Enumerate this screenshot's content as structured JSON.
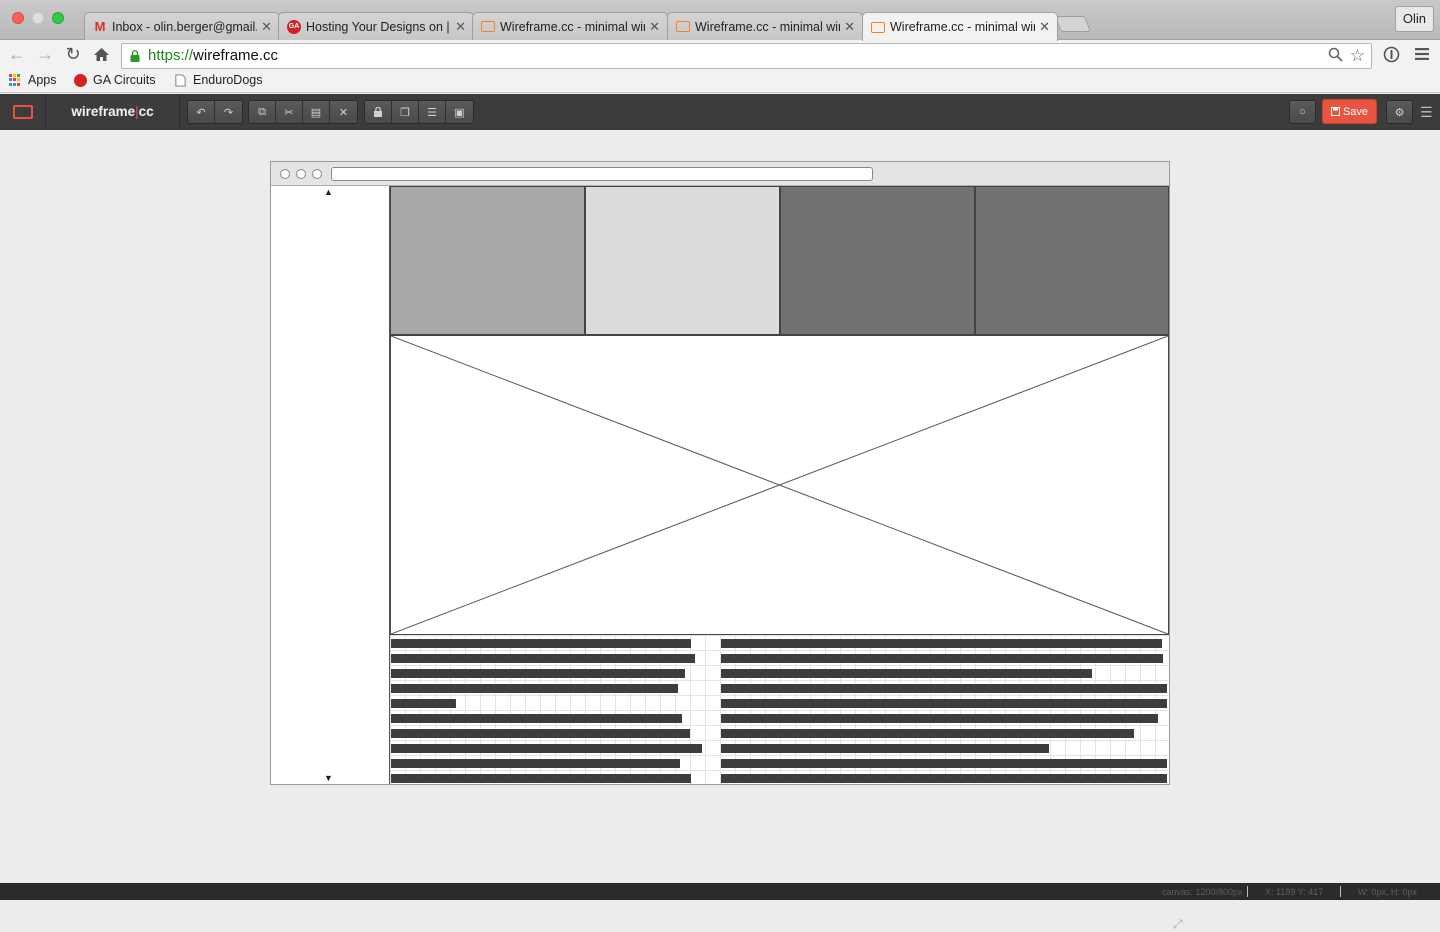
{
  "browser": {
    "tabs": [
      {
        "title": "Inbox - olin.berger@gmail.c",
        "favicon": "gmail-icon"
      },
      {
        "title": "Hosting Your Designs on | ",
        "favicon": "ga-circuits-icon"
      },
      {
        "title": "Wireframe.cc - minimal wir",
        "favicon": "wireframe-icon"
      },
      {
        "title": "Wireframe.cc - minimal wir",
        "favicon": "wireframe-icon"
      },
      {
        "title": "Wireframe.cc - minimal wir",
        "favicon": "wireframe-icon",
        "active": true
      }
    ],
    "profile": "Olin",
    "url_scheme": "https://",
    "url_host": "wireframe.cc",
    "bookmarks": [
      {
        "label": "Apps",
        "icon": "apps-grid-icon"
      },
      {
        "label": "GA Circuits",
        "icon": "ga-circuits-icon"
      },
      {
        "label": "EnduroDogs",
        "icon": "document-icon"
      }
    ]
  },
  "app": {
    "brand_left": "wireframe",
    "brand_sep": "|",
    "brand_right": "cc",
    "save_label": "Save",
    "accent_color": "#e8543f"
  },
  "wireframe": {
    "sidebar": {
      "up_arrow": "▲",
      "down_arrow": "▼"
    },
    "blocks": [
      {
        "name": "block-1",
        "fill": "#a9a9a9"
      },
      {
        "name": "block-2",
        "fill": "#dcdcdc"
      },
      {
        "name": "block-3",
        "fill": "#717171"
      },
      {
        "name": "block-4",
        "fill": "#717171"
      }
    ],
    "image_placeholder": "image-placeholder-icon"
  },
  "status": {
    "canvas": "canvas: 1200/800px",
    "coords": "X: 1189 Y: 417",
    "size": "W: 0px, H: 0px"
  }
}
